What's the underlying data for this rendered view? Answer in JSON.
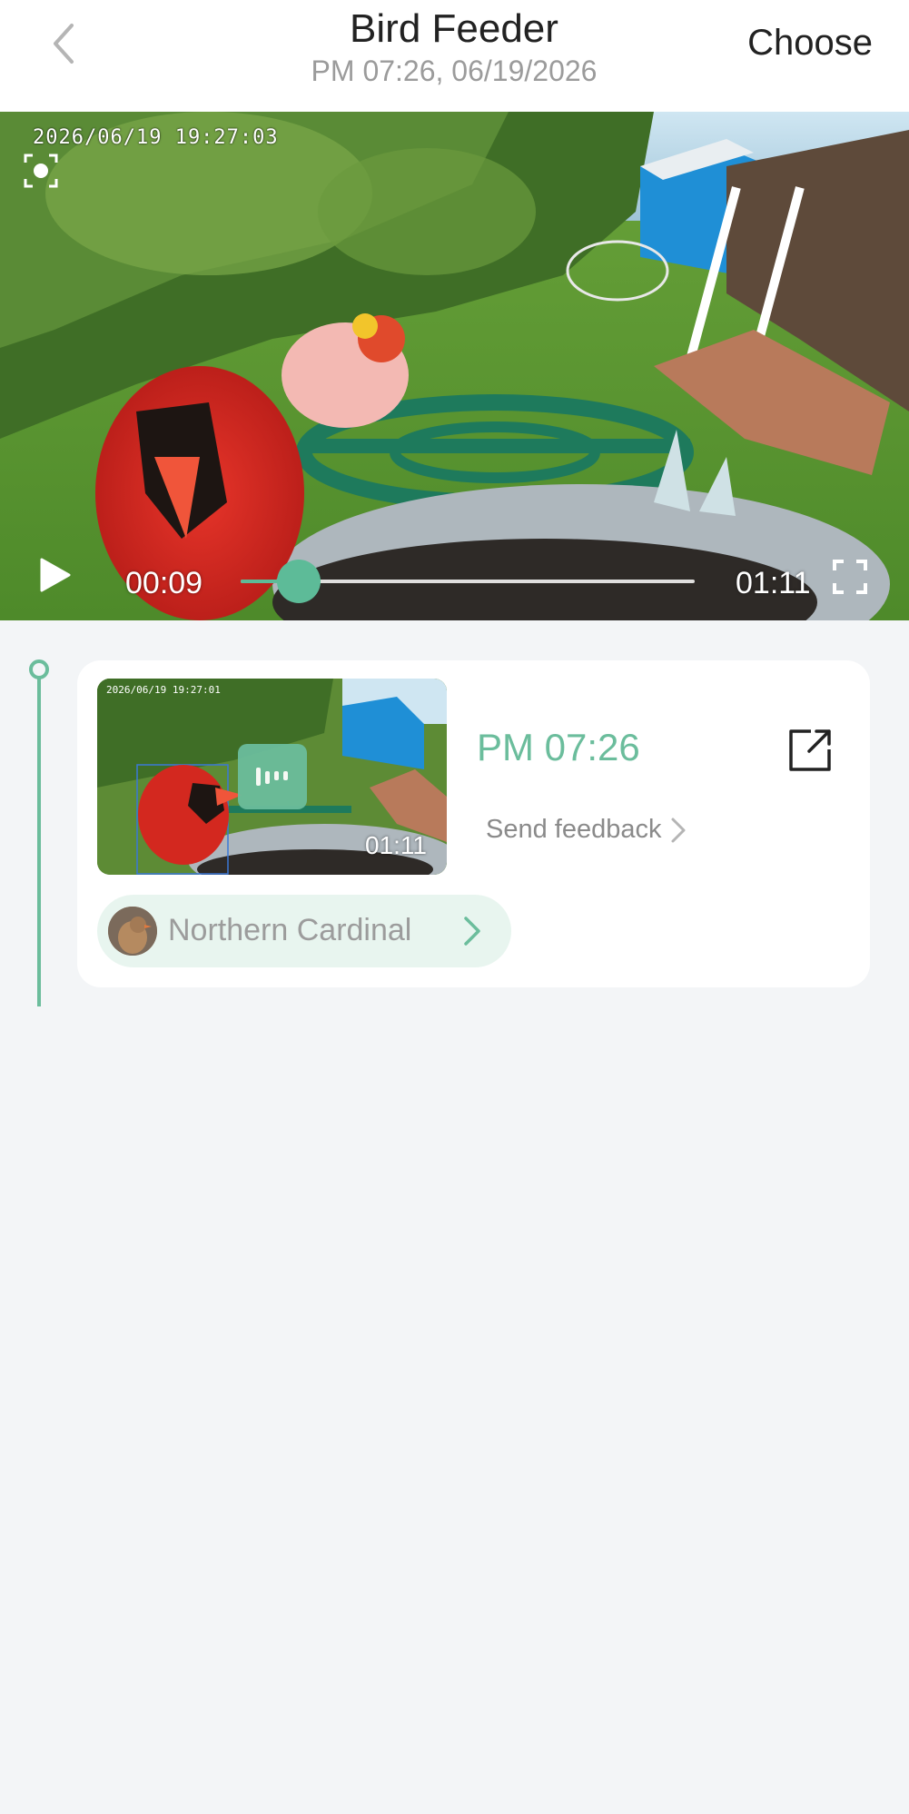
{
  "header": {
    "title": "Bird Feeder",
    "subtitle": "PM 07:26, 06/19/2026",
    "choose_label": "Choose"
  },
  "player": {
    "osd_timestamp": "2026/06/19 19:27:03",
    "current_time": "00:09",
    "total_time": "01:11",
    "progress": 0.127
  },
  "event": {
    "thumb_osd": "2026/06/19 19:27:01",
    "thumb_duration": "01:11",
    "time": "PM 07:26",
    "feedback_label": "Send feedback",
    "species": "Northern Cardinal"
  },
  "colors": {
    "accent": "#6bbd9c",
    "pill_bg": "#e8f5ef"
  }
}
